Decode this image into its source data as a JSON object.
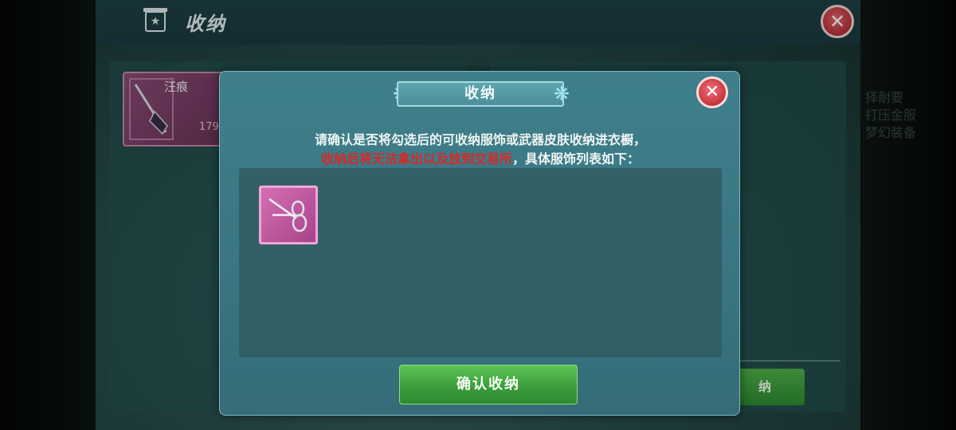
{
  "page": {
    "title": "收纳"
  },
  "background": {
    "item_name": "汪痕",
    "item_count": "179",
    "store_button": "纳",
    "right_hint_lines": [
      "择耐要",
      "打压金服",
      "梦幻装备"
    ]
  },
  "dialog": {
    "title": "收纳",
    "message_line1": "请确认是否将勾选后的可收纳服饰或武器皮肤收纳进衣橱，",
    "message_line2_warning": "收纳后将无法拿出以及放到交易所",
    "message_line2_info": "，具体服饰列表如下：",
    "items": [
      {
        "icon": "scissors-icon"
      }
    ],
    "confirm_label": "确认收纳"
  },
  "colors": {
    "warning": "#d52a2a",
    "confirm_green": "#3a9a3a",
    "close_red": "#c8343e",
    "item_pink": "#d56fb4"
  }
}
